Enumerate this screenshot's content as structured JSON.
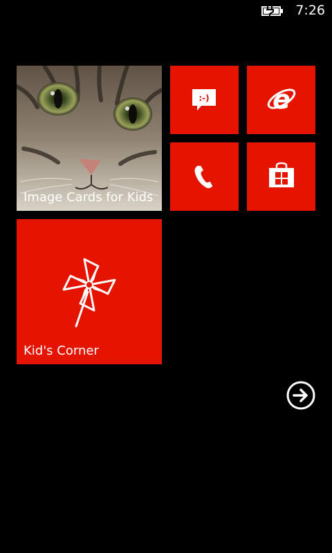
{
  "status_bar": {
    "time": "7:26",
    "battery_icon": "battery-charging-icon"
  },
  "tiles": {
    "image_cards": {
      "label": "Image Cards for Kids",
      "icon": "cat-photo"
    },
    "messaging": {
      "icon": "message-icon"
    },
    "internet_explorer": {
      "icon": "internet-explorer-icon"
    },
    "phone": {
      "icon": "phone-icon"
    },
    "store": {
      "icon": "store-icon"
    },
    "kids_corner": {
      "label": "Kid's Corner",
      "icon": "pinwheel-icon"
    }
  },
  "navigation": {
    "all_apps_icon": "arrow-right-circle-icon"
  },
  "colors": {
    "accent": "#e51400",
    "background": "#000000"
  }
}
